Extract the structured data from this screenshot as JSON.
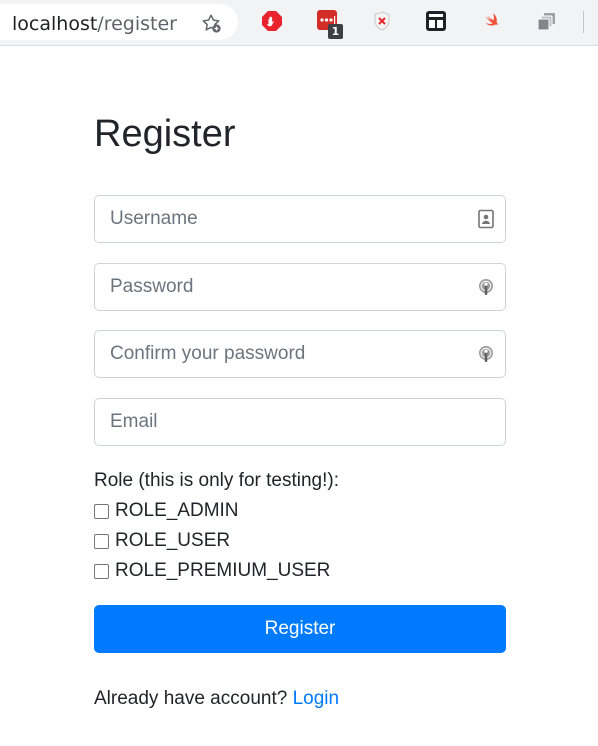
{
  "browser": {
    "url_host": "localhost",
    "url_path": "/register",
    "icons": [
      "bookmark-star-icon",
      "adblock-extension-icon",
      "lastpass-extension-icon",
      "privacy-badger-extension-icon",
      "picture-in-picture-extension-icon",
      "swift-extension-icon",
      "tab-manager-extension-icon"
    ],
    "lastpass_badge": "1"
  },
  "form": {
    "title": "Register",
    "username_placeholder": "Username",
    "password_placeholder": "Password",
    "confirm_placeholder": "Confirm your password",
    "email_placeholder": "Email",
    "role_label": "Role (this is only for testing!):",
    "roles": [
      "ROLE_ADMIN",
      "ROLE_USER",
      "ROLE_PREMIUM_USER"
    ],
    "submit_label": "Register",
    "login_prompt": "Already have account?",
    "login_link": "Login"
  },
  "colors": {
    "primary": "#007bff",
    "text": "#212529",
    "placeholder": "#6c757d",
    "border": "#ced4da"
  }
}
